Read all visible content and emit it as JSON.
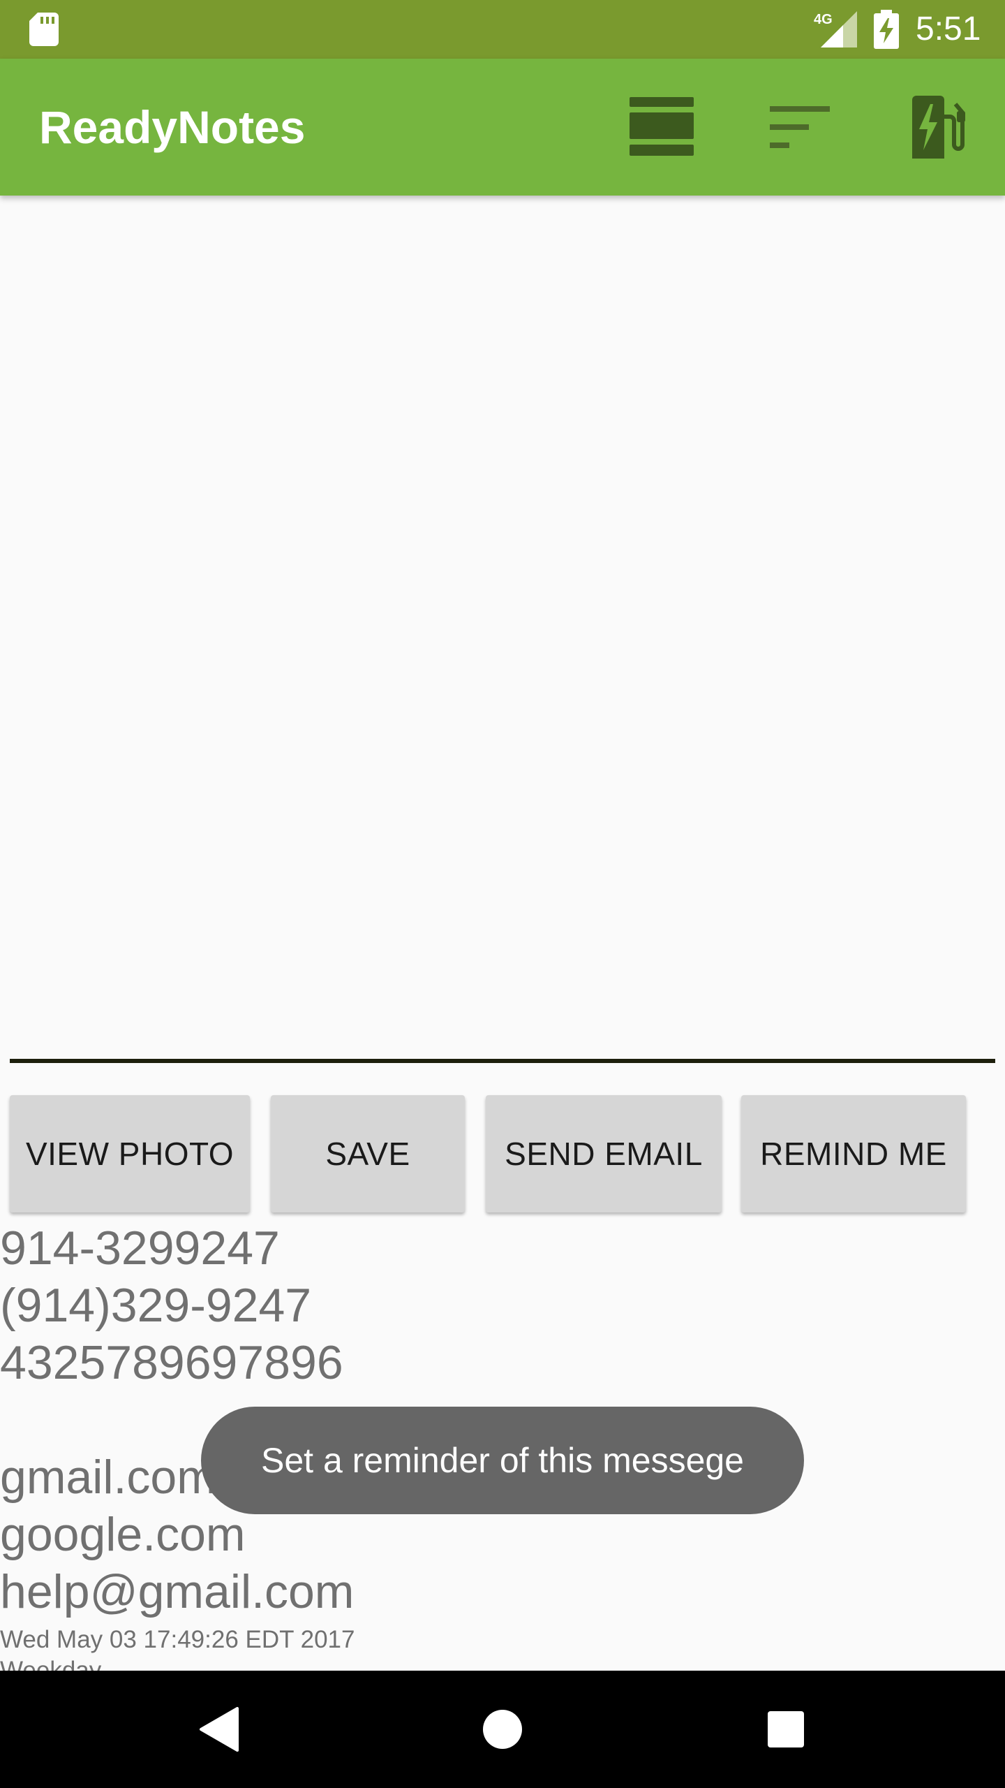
{
  "status_bar": {
    "time": "5:51",
    "network": "4G",
    "icons": [
      "sd-card-icon",
      "signal-icon",
      "battery-charging-icon"
    ]
  },
  "app_bar": {
    "title": "ReadyNotes",
    "actions": [
      "view-stream-icon",
      "sort-icon",
      "ev-station-icon"
    ]
  },
  "note": {
    "text": ""
  },
  "buttons": {
    "view_photo": "VIEW PHOTO",
    "save": "SAVE",
    "send_email": "SEND EMAIL",
    "remind_me": "REMIND ME"
  },
  "content": {
    "lines": [
      "914-3299247",
      "(914)329-9247",
      "4325789697896",
      "gmail.com",
      "google.com",
      "help@gmail.com"
    ],
    "timestamp": "Wed May 03 17:49:26 EDT 2017",
    "partial_line": "Weekday"
  },
  "toast": {
    "message": "Set a reminder of this messege"
  },
  "nav_bar": {
    "buttons": [
      "back-icon",
      "home-icon",
      "recents-icon"
    ]
  },
  "colors": {
    "status_bar": "#7a9a2e",
    "app_bar": "#76b53f",
    "action_icon": "#3c5a1e",
    "button_bg": "#d6d6d6",
    "toast_bg": "#666666"
  }
}
